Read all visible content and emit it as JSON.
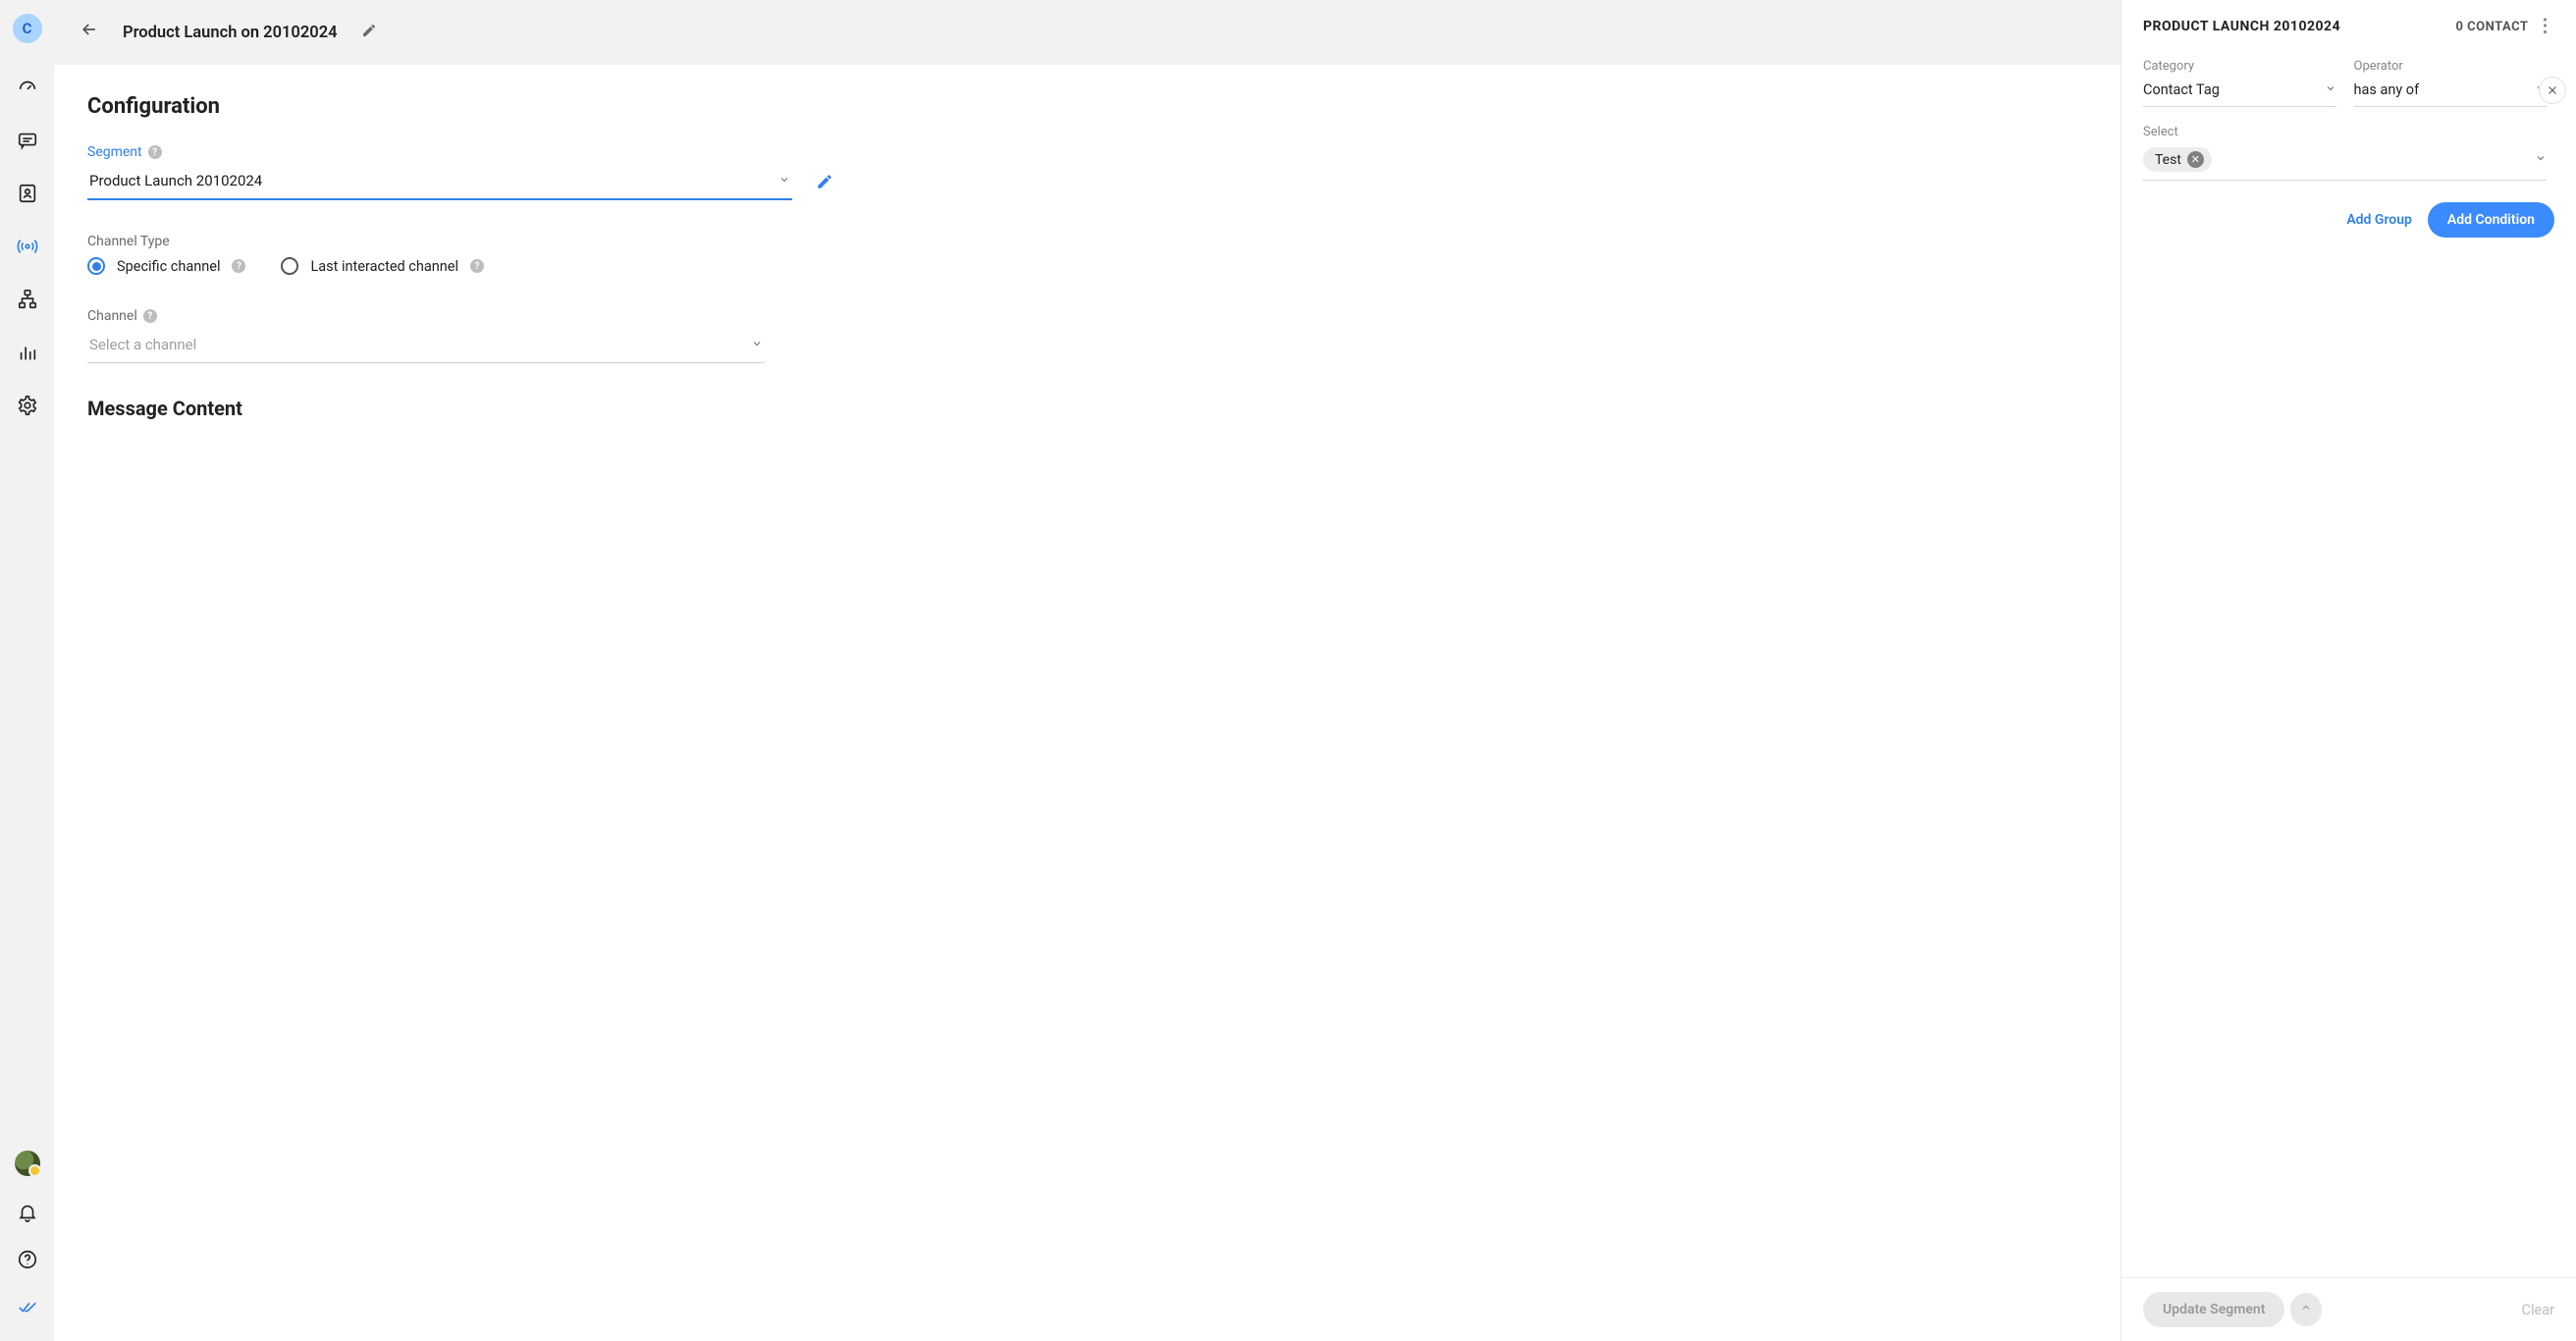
{
  "brand_letter": "C",
  "header": {
    "title": "Product Launch on 20102024"
  },
  "config": {
    "heading": "Configuration",
    "segment": {
      "label": "Segment",
      "value": "Product Launch 20102024"
    },
    "channel_type": {
      "label": "Channel Type",
      "options": {
        "specific": "Specific channel",
        "last": "Last interacted channel"
      }
    },
    "channel": {
      "label": "Channel",
      "placeholder": "Select a channel"
    },
    "message_content_heading": "Message Content"
  },
  "panel": {
    "title": "PRODUCT LAUNCH 20102024",
    "contact_count_label": "0 CONTACT",
    "category": {
      "label": "Category",
      "value": "Contact Tag"
    },
    "operator": {
      "label": "Operator",
      "value": "has any of"
    },
    "select": {
      "label": "Select",
      "tag": "Test"
    },
    "actions": {
      "add_group": "Add Group",
      "add_condition": "Add Condition"
    },
    "footer": {
      "update": "Update Segment",
      "clear": "Clear"
    }
  }
}
